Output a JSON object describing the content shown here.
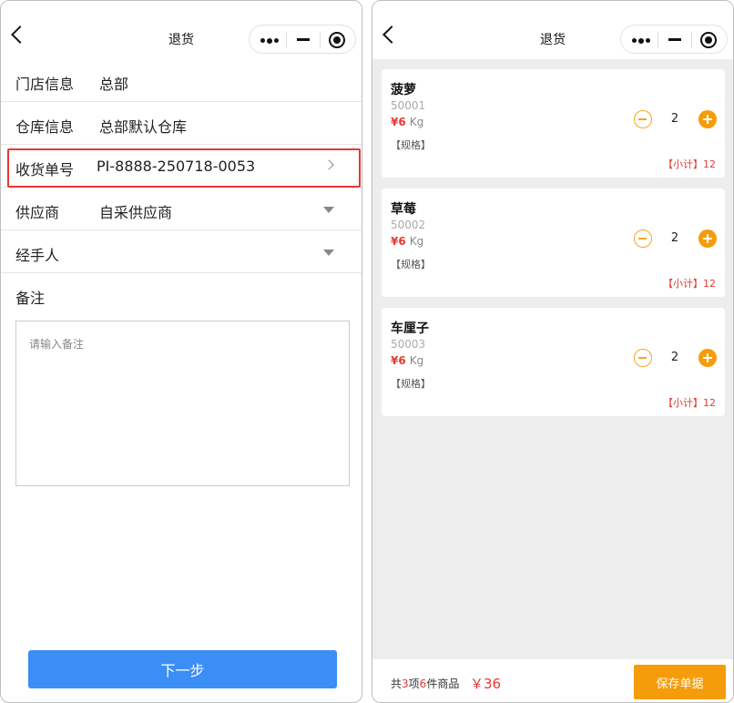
{
  "left": {
    "nav_title": "退货",
    "rows": {
      "store": {
        "label": "门店信息",
        "value": "总部"
      },
      "warehouse": {
        "label": "仓库信息",
        "value": "总部默认仓库"
      },
      "receipt": {
        "label": "收货单号",
        "value": "PI-8888-250718-0053"
      },
      "supplier": {
        "label": "供应商",
        "value": "自采供应商"
      },
      "handler": {
        "label": "经手人",
        "value": ""
      },
      "remark": {
        "label": "备注"
      }
    },
    "remark_placeholder": "请输入备注",
    "next_label": "下一步"
  },
  "right": {
    "nav_title": "退货",
    "products": [
      {
        "name": "菠萝",
        "code": "50001",
        "price": "¥6",
        "unit": "Kg",
        "spec": "【规格】",
        "qty": "2",
        "subtotal_label": "【小计】",
        "subtotal": "12"
      },
      {
        "name": "草莓",
        "code": "50002",
        "price": "¥6",
        "unit": "Kg",
        "spec": "【规格】",
        "qty": "2",
        "subtotal_label": "【小计】",
        "subtotal": "12"
      },
      {
        "name": "车厘子",
        "code": "50003",
        "price": "¥6",
        "unit": "Kg",
        "spec": "【规格】",
        "qty": "2",
        "subtotal_label": "【小计】",
        "subtotal": "12"
      }
    ],
    "footer": {
      "prefix": "共",
      "item_count": "3",
      "middle": "项",
      "piece_count": "6",
      "suffix": "件商品",
      "total": "￥36",
      "save_label": "保存单据"
    }
  },
  "colors": {
    "accent_blue": "#3a8ef6",
    "accent_orange": "#f59c0b",
    "price_red": "#e53935",
    "highlight_red": "#e53935"
  },
  "icons": [
    "back-icon",
    "more-icon",
    "minimize-icon",
    "close-icon",
    "chevron-right-icon",
    "dropdown-arrow-icon",
    "minus-icon",
    "plus-icon"
  ]
}
